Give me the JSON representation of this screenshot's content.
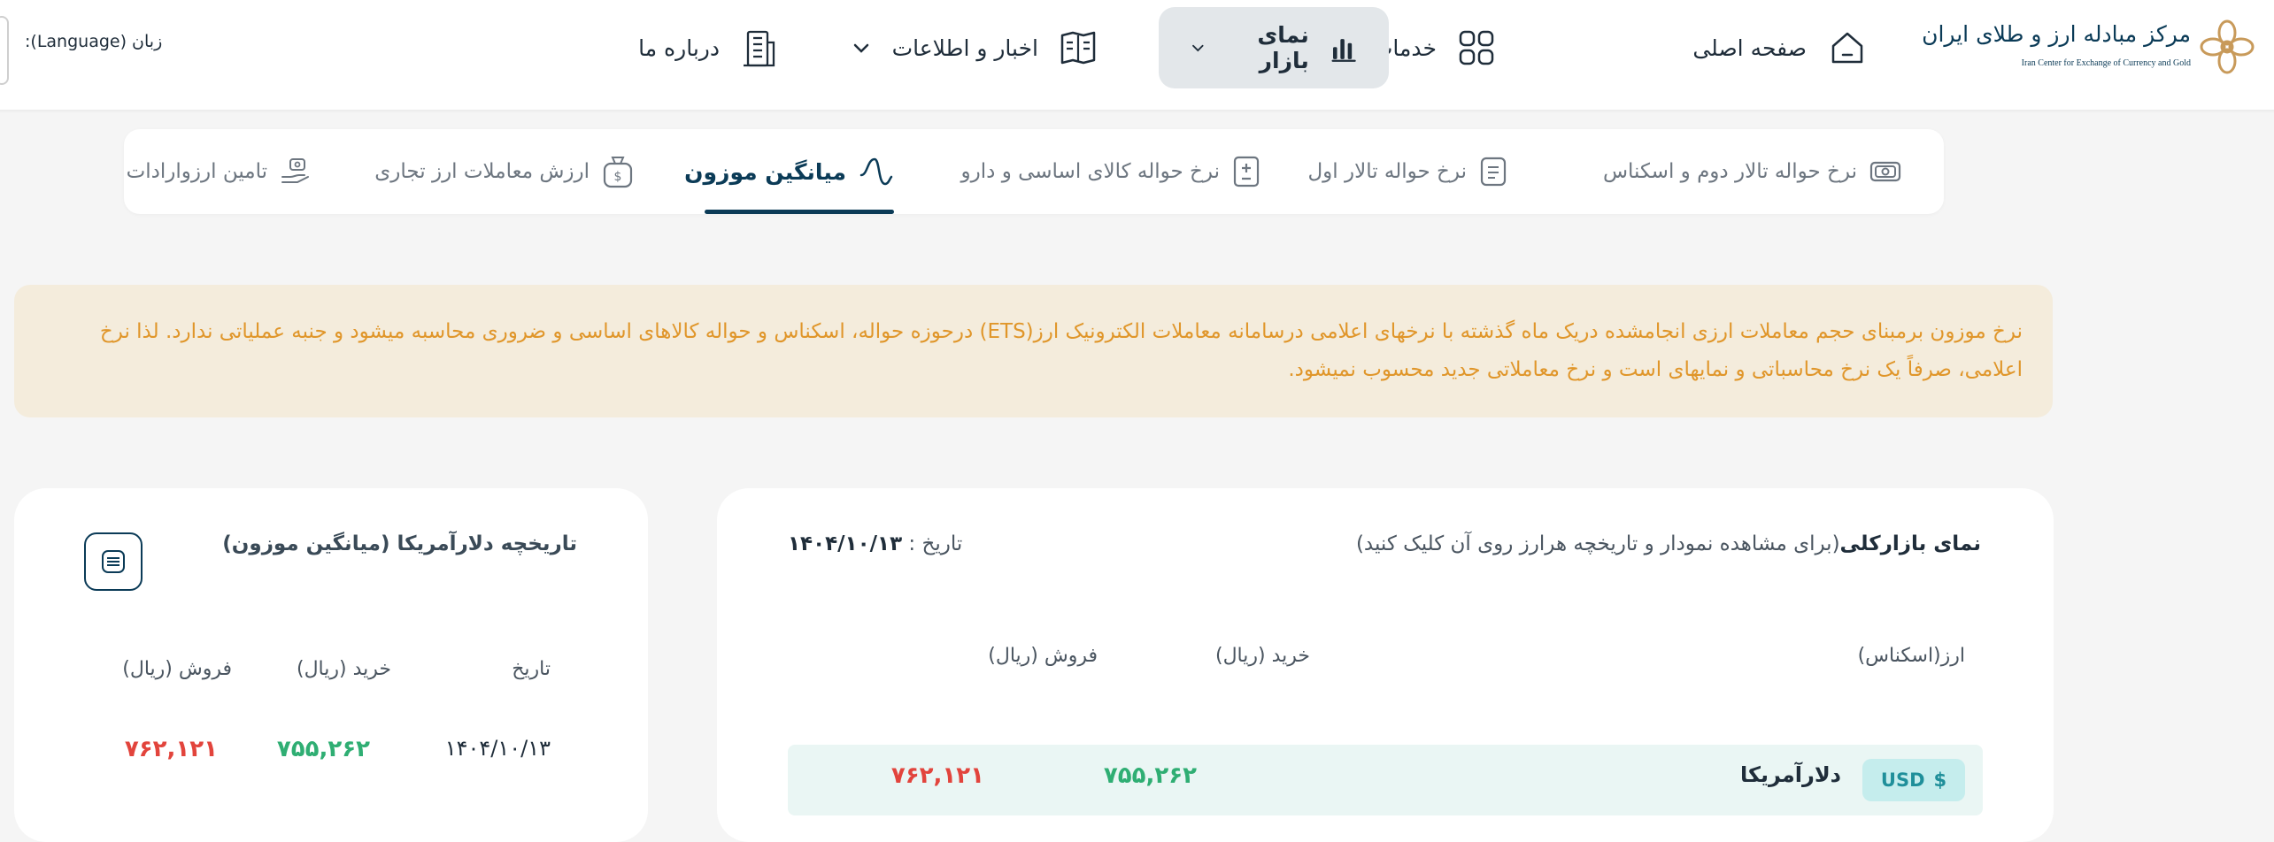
{
  "header": {
    "logo_name_fa": "مرکز مبادله ارز و طلای ایران",
    "logo_name_en": "Iran Center for Exchange of Currency and Gold",
    "nav": {
      "home": "صفحه اصلی",
      "services": "خدمات",
      "market_view": "نمای بازار",
      "news": "اخبار و اطلاعات",
      "about": "درباره ما"
    },
    "language_label": "زبان (Language):"
  },
  "tabs": [
    {
      "label": "نرخ حواله تالار دوم و اسکناس",
      "icon": "cash-icon"
    },
    {
      "label": "نرخ حواله تالار اول",
      "icon": "document-icon"
    },
    {
      "label": "نرخ حواله کالای اساسی و دارو",
      "icon": "plus-minus-icon"
    },
    {
      "label": "میانگین موزون",
      "icon": "wave-icon",
      "active": true
    },
    {
      "label": "ارزش معاملات ارز تجاری",
      "icon": "money-bag-icon"
    },
    {
      "label": "تامین ارزوارادات",
      "icon": "hand-coin-icon"
    }
  ],
  "notice": {
    "text": "نرخ موزون برمبنای حجم معاملات ارزی انجامشده دریک ماه گذشته با نرخهای اعلامی درسامانه معاملات الکترونیک ارز(ETS) درحوزه حواله، اسکناس و حواله کالاهای اساسی و ضروری محاسبه میشود و جنبه عملیاتی ندارد. لذا نرخ اعلامی، صرفاً یک نرخ محاسباتی و نمایهای است و نرخ معاملاتی جدید محسوب نمیشود."
  },
  "overview": {
    "title": "نمای بازارکلی",
    "subtitle": "(برای مشاهده نمودار و تاریخچه هرارز روی آن کلیک کنید)",
    "date_label": "تاریخ :",
    "date_value": "۱۴۰۴/۱۰/۱۳",
    "columns": {
      "currency": "ارز(اسکناس)",
      "buy": "خرید (ریال)",
      "sell": "فروش (ریال)"
    },
    "rows": [
      {
        "code": "USD",
        "symbol": "$",
        "name": "دلارآمریکا",
        "buy": "۷۵۵,۲۶۲",
        "sell": "۷۶۲,۱۲۱"
      }
    ]
  },
  "history": {
    "title": "تاریخچه دلارآمریکا (میانگین موزون)",
    "columns": {
      "date": "تاریخ",
      "buy": "خرید (ریال)",
      "sell": "فروش (ریال)"
    },
    "rows": [
      {
        "date": "۱۴۰۴/۱۰/۱۳",
        "buy": "۷۵۵,۲۶۲",
        "sell": "۷۶۲,۱۲۱"
      }
    ]
  },
  "colors": {
    "brand": "#0b3b57",
    "buy": "#2fae73",
    "sell": "#e2443c",
    "notice_text": "#e0962a",
    "notice_bg": "#f4ecdc"
  }
}
